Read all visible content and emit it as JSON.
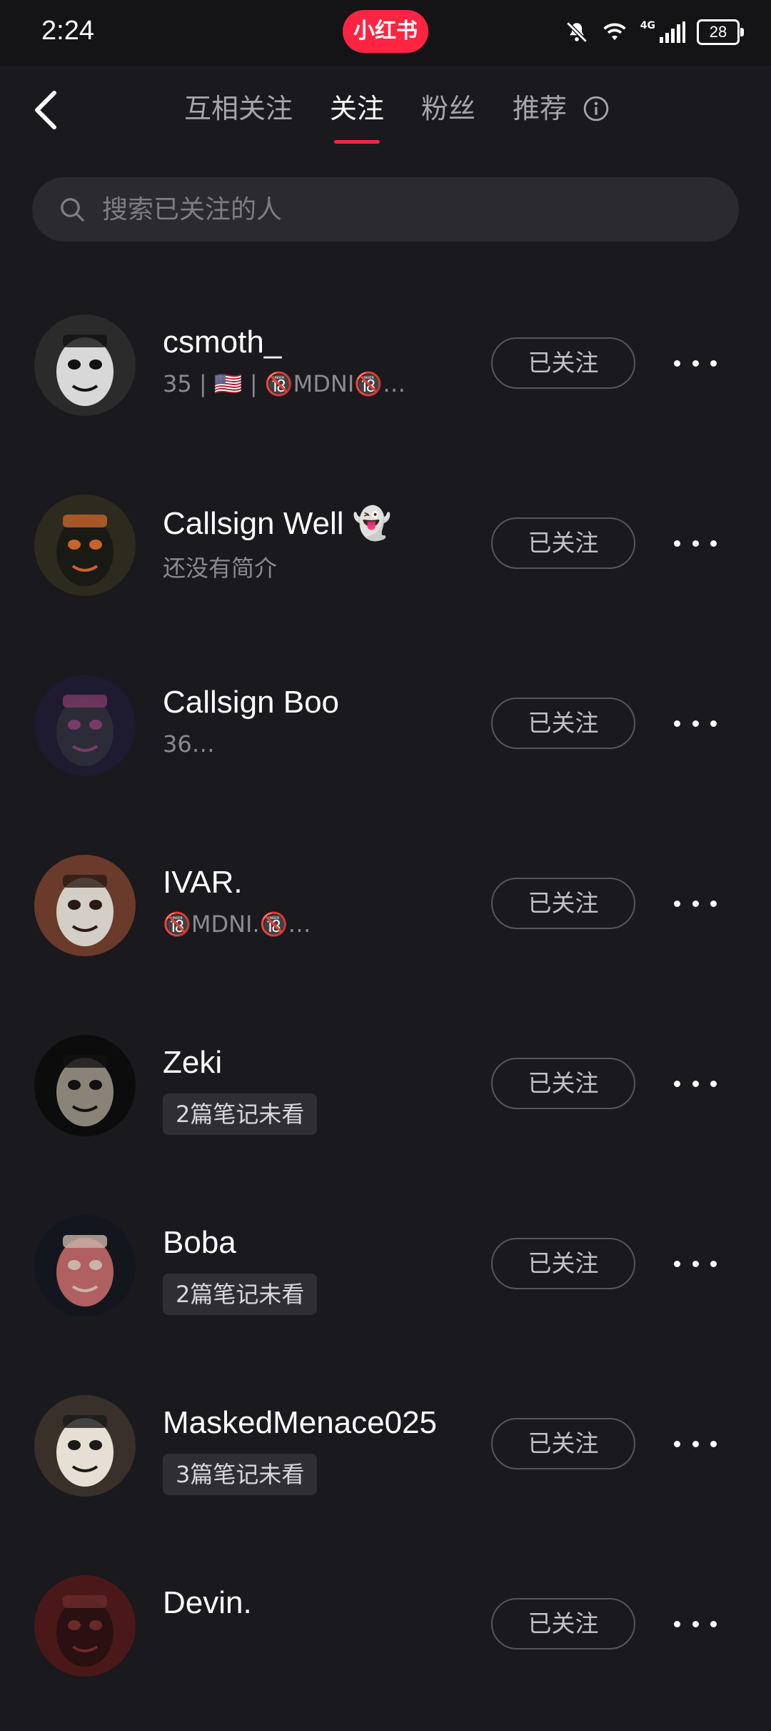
{
  "status_bar": {
    "time": "2:24",
    "app_badge": "小红书",
    "network": "4G",
    "battery": "28"
  },
  "nav": {
    "tabs": [
      {
        "label": "互相关注",
        "active": false
      },
      {
        "label": "关注",
        "active": true
      },
      {
        "label": "粉丝",
        "active": false
      },
      {
        "label": "推荐",
        "active": false
      }
    ]
  },
  "search": {
    "placeholder": "搜索已关注的人"
  },
  "colors": {
    "accent": "#ff2442",
    "background": "#19191e"
  },
  "users": [
    {
      "name": "csmoth_",
      "bio": "35 | 🇺🇸 | 🔞MDNI🔞…",
      "badge": "",
      "follow_label": "已关注",
      "avatar": {
        "bg": "#2b2b2b",
        "mask": "#d8d8d8",
        "accent": "#111"
      }
    },
    {
      "name": "Callsign Well 👻",
      "bio": "还没有简介",
      "badge": "",
      "follow_label": "已关注",
      "avatar": {
        "bg": "#2d2a1e",
        "mask": "#1a1a14",
        "accent": "#c8642a"
      }
    },
    {
      "name": "Callsign Boo",
      "bio": "36…",
      "badge": "",
      "follow_label": "已关注",
      "avatar": {
        "bg": "#1e1a30",
        "mask": "#2c2b38",
        "accent": "#7a3a68"
      }
    },
    {
      "name": "IVAR.",
      "bio": "🔞MDNI.🔞…",
      "badge": "",
      "follow_label": "已关注",
      "avatar": {
        "bg": "#6a3a2a",
        "mask": "#d4cfc6",
        "accent": "#2a1a14"
      }
    },
    {
      "name": "Zeki",
      "bio": "",
      "badge": "2篇笔记未看",
      "follow_label": "已关注",
      "avatar": {
        "bg": "#0c0c0c",
        "mask": "#8a8478",
        "accent": "#111"
      }
    },
    {
      "name": "Boba",
      "bio": "",
      "badge": "2篇笔记未看",
      "follow_label": "已关注",
      "avatar": {
        "bg": "#14161e",
        "mask": "#b06060",
        "accent": "#c8b4a8"
      }
    },
    {
      "name": "MaskedMenace025",
      "bio": "",
      "badge": "3篇笔记未看",
      "follow_label": "已关注",
      "avatar": {
        "bg": "#3a302a",
        "mask": "#e6e0d4",
        "accent": "#1a1a1a"
      }
    },
    {
      "name": "Devin.",
      "bio": "",
      "badge": "",
      "follow_label": "已关注",
      "avatar": {
        "bg": "#4a1818",
        "mask": "#2a1010",
        "accent": "#6a2a2a"
      }
    }
  ]
}
